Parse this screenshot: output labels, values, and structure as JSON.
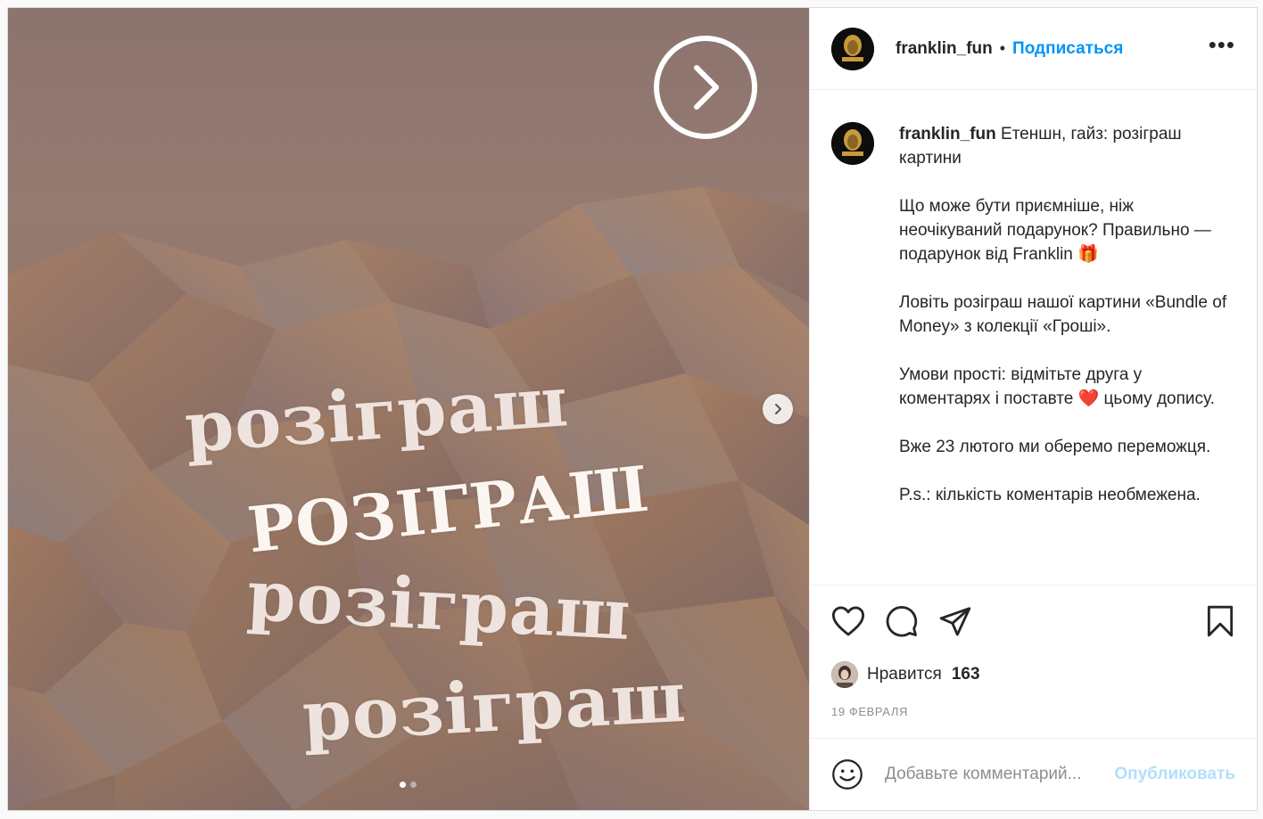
{
  "post": {
    "media": {
      "words": [
        "розіграш",
        "РОЗІГРАШ",
        "розіграш",
        "розіграш"
      ],
      "slide_count": 2,
      "active_slide": 1
    },
    "header": {
      "username": "franklin_fun",
      "separator": "•",
      "follow_label": "Подписаться",
      "more_icon": "more-options-icon"
    },
    "caption": {
      "username": "franklin_fun",
      "title": "Етеншн, гайз: розіграш картини",
      "paragraphs": [
        "Що може бути приємніше, ніж неочікуваний подарунок? Правильно — подарунок від Franklin 🎁",
        "Ловіть розіграш нашої картини «Bundle of Money» з колекції «Гроші».",
        "Умови прості: відмітьте друга у коментарях і поставте ❤️ цьому допису.",
        "Вже 23 лютого ми оберемо переможця.",
        "P.s.: кількість коментарів необмежена."
      ]
    },
    "likes": {
      "label": "Нравится",
      "count": "163"
    },
    "date": "19 февраля",
    "comment": {
      "placeholder": "Добавьте комментарий...",
      "publish_label": "Опубликовать"
    }
  },
  "colors": {
    "accent": "#0095f6",
    "publish_disabled": "#b2dffc",
    "text": "#262626",
    "muted": "#8e8e8e"
  }
}
